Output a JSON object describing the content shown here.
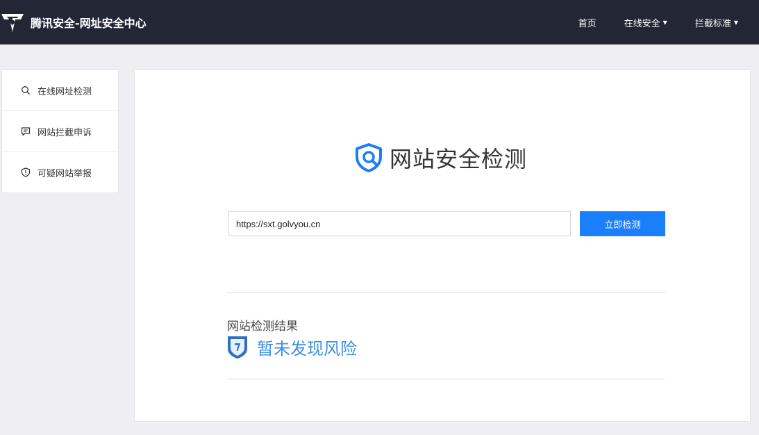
{
  "header": {
    "title": "腾讯安全-网址安全中心",
    "nav": [
      {
        "label": "首页",
        "has_caret": false
      },
      {
        "label": "在线安全",
        "has_caret": true
      },
      {
        "label": "拦截标准",
        "has_caret": true
      }
    ]
  },
  "sidebar": {
    "items": [
      {
        "label": "在线网址检测",
        "icon": "search-icon"
      },
      {
        "label": "网站拦截申诉",
        "icon": "message-icon"
      },
      {
        "label": "可疑网站举报",
        "icon": "shield-alert-icon"
      }
    ]
  },
  "main": {
    "title": "网站安全检测",
    "url_value": "https://sxt.golvyou.cn",
    "check_button": "立即检测",
    "result_heading": "网站检测结果",
    "result_text": "暂未发现风险"
  },
  "colors": {
    "accent": "#1b7efb",
    "header_bg": "#232635",
    "result_blue": "#3a8fe6"
  }
}
